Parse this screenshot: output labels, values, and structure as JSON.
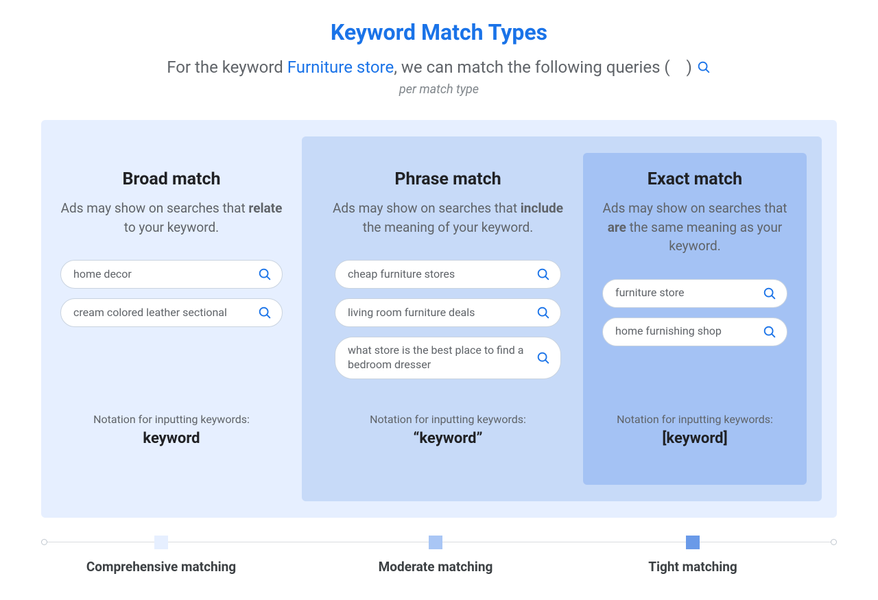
{
  "title": "Keyword Match Types",
  "subtitle_prefix": "For the keyword ",
  "subtitle_keyword": "Furniture store",
  "subtitle_mid": ", we can match the following queries (",
  "subtitle_paren_close": ")",
  "subtitle2": "per match type",
  "columns": {
    "broad": {
      "title": "Broad match",
      "desc_pre": "Ads may show on searches that ",
      "desc_bold": "relate",
      "desc_post": " to your keyword.",
      "pills": [
        "home decor",
        "cream colored leather sectional"
      ],
      "notation_label": "Notation for inputting keywords:",
      "notation_value": "keyword"
    },
    "phrase": {
      "title": "Phrase match",
      "desc_pre": "Ads may show on searches that ",
      "desc_bold": "include",
      "desc_post": " the meaning of your keyword.",
      "pills": [
        "cheap furniture stores",
        "living room furniture deals",
        "what store is the best place to find a bedroom dresser"
      ],
      "notation_label": "Notation for inputting keywords:",
      "notation_value": "“keyword”"
    },
    "exact": {
      "title": "Exact match",
      "desc_pre": "Ads may show on searches that ",
      "desc_bold": "are",
      "desc_post": " the same meaning as your keyword.",
      "pills": [
        "furniture store",
        "home furnishing shop"
      ],
      "notation_label": "Notation for inputting keywords:",
      "notation_value": "[keyword]"
    }
  },
  "spectrum": {
    "l1": "Comprehensive matching",
    "l2": "Moderate matching",
    "l3": "Tight matching"
  }
}
